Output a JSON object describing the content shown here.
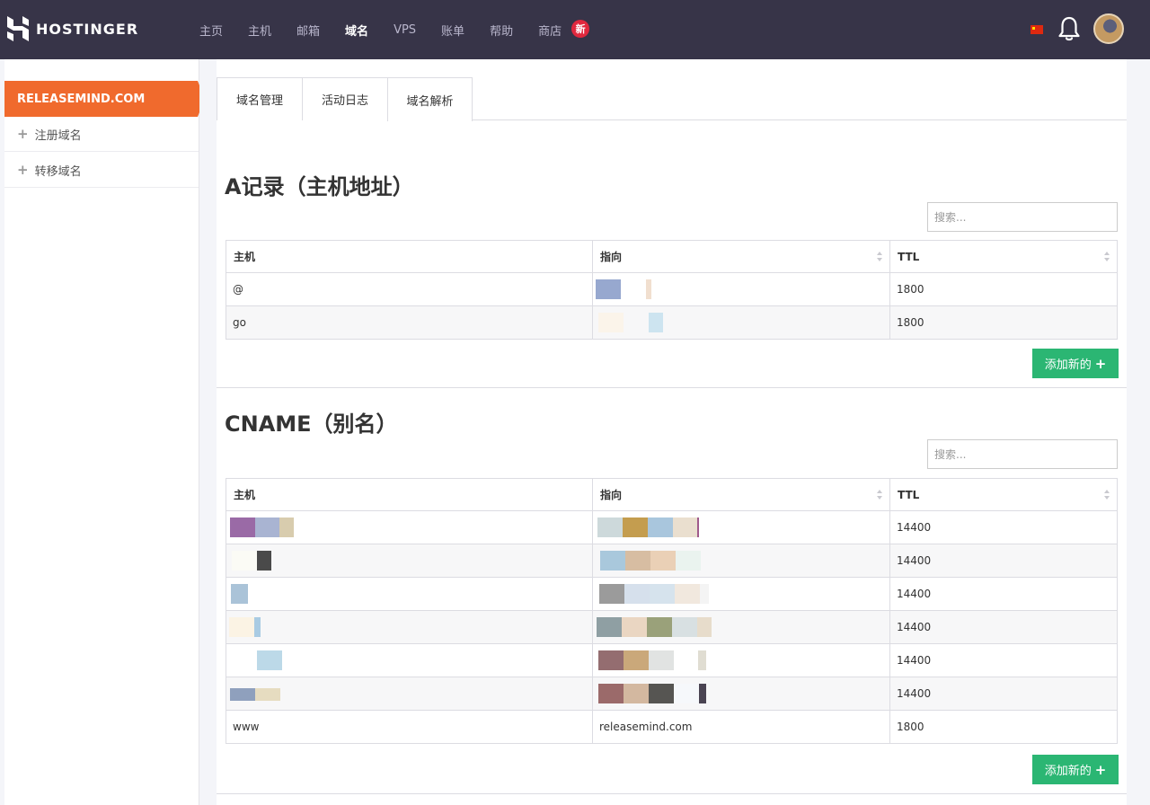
{
  "brand": {
    "name": "HOSTINGER"
  },
  "nav": {
    "items": [
      {
        "label": "主页"
      },
      {
        "label": "主机"
      },
      {
        "label": "邮箱"
      },
      {
        "label": "域名",
        "active": true
      },
      {
        "label": "VPS"
      },
      {
        "label": "账单"
      },
      {
        "label": "帮助"
      },
      {
        "label": "商店",
        "badge": "新"
      }
    ]
  },
  "header_icons": {
    "flag": "china-flag-icon",
    "bell": "bell-icon",
    "avatar": "avatar"
  },
  "sidebar": {
    "domain": "RELEASEMIND.COM",
    "items": [
      {
        "label": "注册域名",
        "icon": "plus-icon"
      },
      {
        "label": "转移域名",
        "icon": "plus-icon"
      }
    ]
  },
  "tabs": [
    {
      "label": "域名管理"
    },
    {
      "label": "活动日志"
    },
    {
      "label": "域名解析",
      "active": true
    }
  ],
  "a_records": {
    "title": "A记录（主机地址）",
    "search_placeholder": "搜索...",
    "columns": [
      "主机",
      "指向",
      "TTL"
    ],
    "rows": [
      {
        "host": "@",
        "points_to": "",
        "ttl": "1800"
      },
      {
        "host": "go",
        "points_to": "",
        "ttl": "1800"
      }
    ],
    "add_label": "添加新的"
  },
  "cname_records": {
    "title": "CNAME（别名）",
    "search_placeholder": "搜索...",
    "columns": [
      "主机",
      "指向",
      "TTL"
    ],
    "rows": [
      {
        "host": "",
        "points_to": "",
        "ttl": "14400"
      },
      {
        "host": "",
        "points_to": "",
        "ttl": "14400"
      },
      {
        "host": "",
        "points_to": "",
        "ttl": "14400"
      },
      {
        "host": "",
        "points_to": "",
        "ttl": "14400"
      },
      {
        "host": "",
        "points_to": "",
        "ttl": "14400"
      },
      {
        "host": "",
        "points_to": "",
        "ttl": "14400"
      },
      {
        "host": "www",
        "points_to": "releasemind.com",
        "ttl": "1800"
      }
    ],
    "add_label": "添加新的"
  },
  "colors": {
    "topbar": "#373448",
    "accent_orange": "#f06a2d",
    "add_green": "#2bb673",
    "badge_red": "#e0283e"
  }
}
